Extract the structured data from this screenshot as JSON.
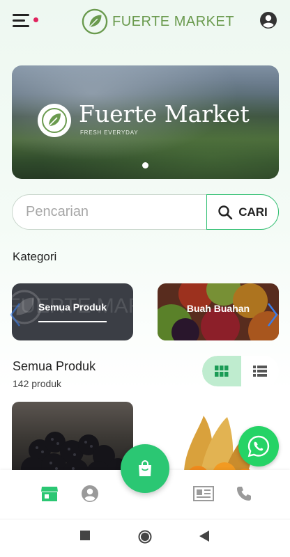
{
  "header": {
    "brand_name": "FUERTE MARKET",
    "icons": {
      "menu": "hamburger-menu-icon",
      "account": "account-circle-icon"
    },
    "notification_dot_color": "#e0245e"
  },
  "banner": {
    "title": "Fuerte Market",
    "subtitle": "FRESH EVERYDAY",
    "slide_indicator": {
      "current": 1,
      "total": 1
    }
  },
  "search": {
    "placeholder": "Pencarian",
    "value": "",
    "button_label": "CARI",
    "icon": "search-icon"
  },
  "categories": {
    "title": "Kategori",
    "items": [
      {
        "label": "Semua Produk",
        "selected": true,
        "watermark": "FUERTE MARK"
      },
      {
        "label": "Buah Buahan",
        "selected": false
      }
    ]
  },
  "products": {
    "title": "Semua Produk",
    "count_text": "142 produk",
    "view_mode": "grid",
    "items": [
      {
        "image": "blackberries"
      },
      {
        "image": "physalis"
      }
    ]
  },
  "bottom_nav": {
    "items": [
      {
        "icon": "store-icon",
        "active": true
      },
      {
        "icon": "account-circle-icon",
        "active": false
      },
      {
        "icon": "shopping-bag-icon",
        "active": false,
        "center": true
      },
      {
        "icon": "newspaper-icon",
        "active": false
      },
      {
        "icon": "phone-icon",
        "active": false
      }
    ]
  },
  "colors": {
    "primary": "#2bc773",
    "brand_green": "#6a9a4e",
    "whatsapp": "#25d366",
    "active_nav": "#2bc773",
    "inactive_nav": "#9a9a9a"
  }
}
